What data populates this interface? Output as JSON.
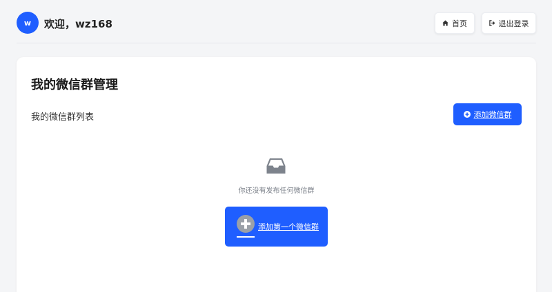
{
  "header": {
    "avatar_letter": "w",
    "welcome": "欢迎，wz168",
    "home_label": "首页",
    "logout_label": "退出登录"
  },
  "card": {
    "title": "我的微信群管理",
    "list_label": "我的微信群列表",
    "add_button": "添加微信群",
    "empty_text": "你还没有发布任何微信群",
    "add_first_button": "添加第一个微信群"
  },
  "colors": {
    "accent": "#1f5eff",
    "background": "#f4f5f7",
    "muted_text": "#7a7f88"
  },
  "icons": {
    "home": "home-icon",
    "logout": "logout-icon",
    "add": "plus-circle-icon",
    "empty": "inbox-icon"
  }
}
